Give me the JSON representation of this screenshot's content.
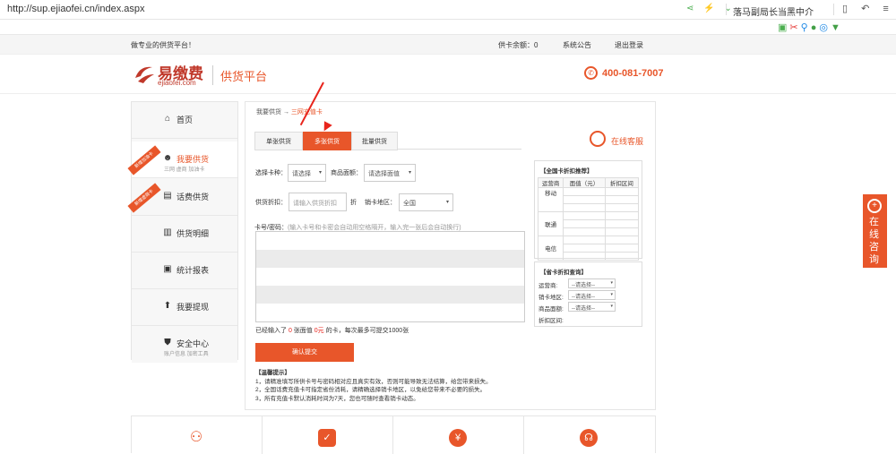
{
  "browser": {
    "url": "http://sup.ejiaofei.cn/index.aspx",
    "news": "落马副局长当黑中介"
  },
  "topbar": {
    "slogan": "做专业的供货平台！",
    "balance": "供卡余额：0",
    "notice": "系统公告",
    "logout": "退出登录"
  },
  "header": {
    "logo": "易缴费",
    "logo_sub": "ejiaofei.com",
    "platform": "供货平台",
    "hotline": "400-081-7007"
  },
  "sidebar": {
    "items": [
      {
        "label": "首页",
        "icon": "home-icon"
      },
      {
        "label": "我要供货",
        "sub": "三网 虚商 加油卡",
        "ribbon": "新增加油卡"
      },
      {
        "label": "话费供货",
        "ribbon": "新增虚商卡"
      },
      {
        "label": "供货明细"
      },
      {
        "label": "统计报表"
      },
      {
        "label": "我要提现"
      },
      {
        "label": "安全中心",
        "sub": "账户信息 加密工具"
      }
    ]
  },
  "breadcrumb": {
    "root": "我要供货",
    "sep": "→",
    "current": "三网充值卡"
  },
  "tabs": [
    "单张供货",
    "多张供货",
    "批量供货"
  ],
  "service": "在线客服",
  "form": {
    "card_type_label": "选择卡种：",
    "card_type_value": "请选择",
    "denom_label": "商品面额：",
    "denom_value": "请选择面值",
    "discount_label": "供货折扣：",
    "discount_placeholder": "请输入供货折扣",
    "discount_unit": "折",
    "region_label": "销卡地区：",
    "region_value": "全国",
    "cards_label": "卡号/密码：",
    "cards_hint": "(输入卡号和卡密会自动用空格隔开，输入完一张后会自动换行)",
    "count_prefix": "已经输入了",
    "count_num": "0",
    "count_mid": "张面值",
    "count_val": "0元",
    "count_suffix": "的卡，每次最多可提交1000张",
    "submit": "确认提交"
  },
  "tips": {
    "title": "【温馨提示】",
    "lines": [
      "1，请精准填写所供卡号与密码相对应且真实有效，否则可能导致无法结算，给您带来损失。",
      "2，全国话费充值卡可指定省份消耗，请精确选择销卡地区，以免给您带来不必要的损失。",
      "3，所有充值卡默认消耗时间为7天，您也可随时查看销卡动态。"
    ]
  },
  "rate_box": {
    "title": "【全国卡折扣推荐】",
    "headers": [
      "运营商",
      "面值（元）",
      "折扣区间"
    ],
    "rows": [
      "移动",
      "联通",
      "电信"
    ]
  },
  "query_box": {
    "title": "【省卡折扣查询】",
    "labels": [
      "运营商:",
      "销卡地区:",
      "商品面额:",
      "折扣区间:"
    ],
    "placeholder": "--请选择--"
  },
  "float_consult": "在线咨询",
  "colors": {
    "accent": "#e8562a",
    "arrow": "#e8241c"
  }
}
